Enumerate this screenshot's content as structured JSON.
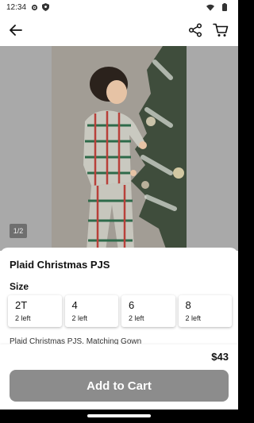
{
  "status_bar": {
    "time": "12:34",
    "icons": [
      "gear-icon",
      "shield-icon",
      "wifi-icon",
      "battery-icon"
    ]
  },
  "app_bar": {
    "icons": [
      "back-arrow-icon",
      "share-icon",
      "cart-icon"
    ]
  },
  "gallery": {
    "counter": "1/2"
  },
  "product": {
    "title": "Plaid Christmas PJS",
    "size_label": "Size",
    "sizes": [
      {
        "size": "2T",
        "stock": "2 left"
      },
      {
        "size": "4",
        "stock": "2 left"
      },
      {
        "size": "6",
        "stock": "2 left"
      },
      {
        "size": "8",
        "stock": "2 left"
      }
    ],
    "description": "Plaid Christmas PJS. Matching Gown"
  },
  "footer": {
    "price": "$43",
    "add_to_cart": "Add to Cart"
  },
  "colors": {
    "button": "#8c8c8c",
    "photo_surround": "#a9a9a9"
  }
}
